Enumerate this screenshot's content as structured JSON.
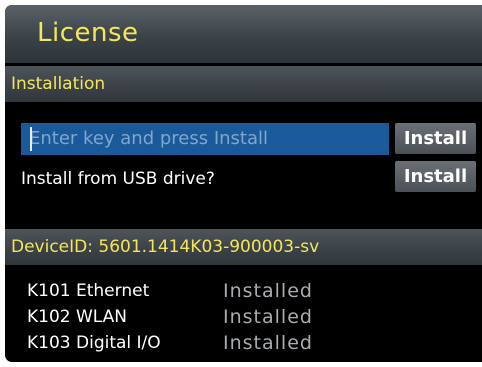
{
  "window": {
    "title": "License"
  },
  "installation": {
    "header": "Installation",
    "key_input": {
      "placeholder": "Enter key and press Install",
      "value": ""
    },
    "install_key_button": "Install",
    "usb_label": "Install from USB drive?",
    "install_usb_button": "Install"
  },
  "device": {
    "header": "DeviceID: 5601.1414K03-900003-sv"
  },
  "licenses": [
    {
      "name": "K101 Ethernet",
      "status": "Installed"
    },
    {
      "name": "K102 WLAN",
      "status": "Installed"
    },
    {
      "name": "K103 Digital I/O",
      "status": "Installed"
    }
  ],
  "colors": {
    "accent_text": "#f4e65a",
    "input_background": "#1b5a9a",
    "screen_background": "#000000",
    "status_text": "#a8acb0"
  }
}
